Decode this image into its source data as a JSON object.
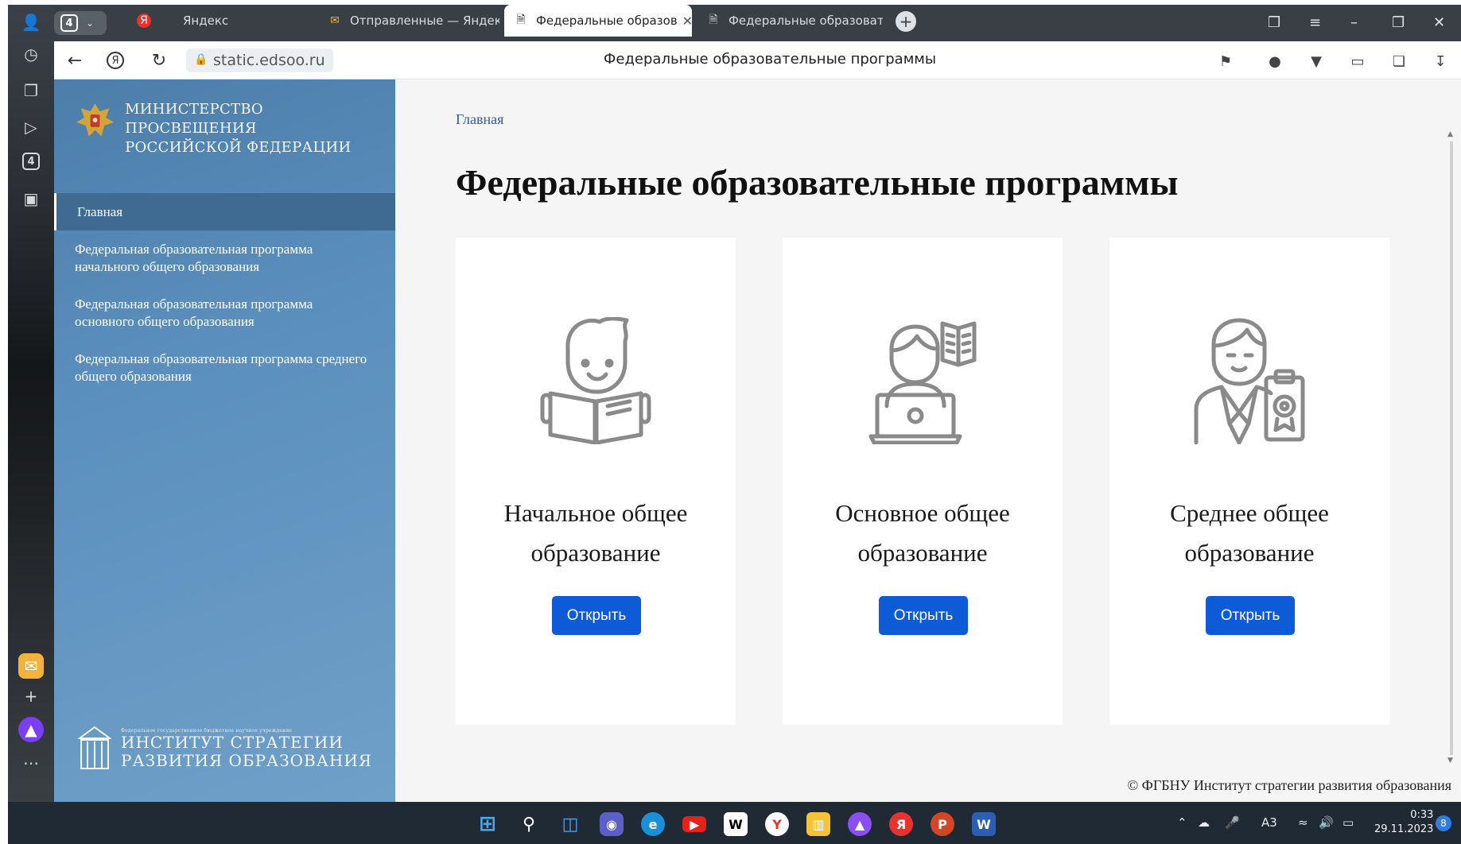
{
  "browser": {
    "tab_count": "4",
    "tabs": [
      {
        "label": "Яндекс",
        "icon": "yandex-icon"
      },
      {
        "label": "Отправленные — Яндекс",
        "icon": "mail-icon"
      },
      {
        "label": "Федеральные образов",
        "icon": "page-icon"
      },
      {
        "label": "Федеральные образовате",
        "icon": "page-icon"
      }
    ],
    "address": "static.edsoo.ru",
    "page_title": "Федеральные образовательные программы"
  },
  "sidebar": {
    "ministry_line1": "МИНИСТЕРСТВО ПРОСВЕЩЕНИЯ",
    "ministry_line2": "РОССИЙСКОЙ ФЕДЕРАЦИИ",
    "items": [
      {
        "label": "Главная"
      },
      {
        "label": "Федеральная образовательная программа начального общего образования"
      },
      {
        "label": "Федеральная образовательная программа основного общего образования"
      },
      {
        "label": "Федеральная образовательная программа среднего общего образования"
      }
    ],
    "institute_small": "Федеральное государственное бюджетное научное учреждение",
    "institute_line1": "ИНСТИТУТ СТРАТЕГИИ",
    "institute_line2": "РАЗВИТИЯ ОБРАЗОВАНИЯ"
  },
  "main": {
    "breadcrumb": "Главная",
    "heading": "Федеральные образовательные программы",
    "cards": [
      {
        "title": "Начальное общее образование",
        "button": "Открыть",
        "icon": "child-reading-icon"
      },
      {
        "title": "Основное общее образование",
        "button": "Открыть",
        "icon": "student-laptop-icon"
      },
      {
        "title": "Среднее общее образование",
        "button": "Открыть",
        "icon": "graduate-clipboard-icon"
      }
    ],
    "footer": "© ФГБНУ Институт стратегии развития образования"
  },
  "taskbar": {
    "lang": "A3",
    "time": "0:33",
    "date": "29.11.2023",
    "notifications": "8"
  },
  "colors": {
    "sidebar": "#5b8fbd",
    "button": "#0d5bd7",
    "link": "#2b5aa8"
  }
}
